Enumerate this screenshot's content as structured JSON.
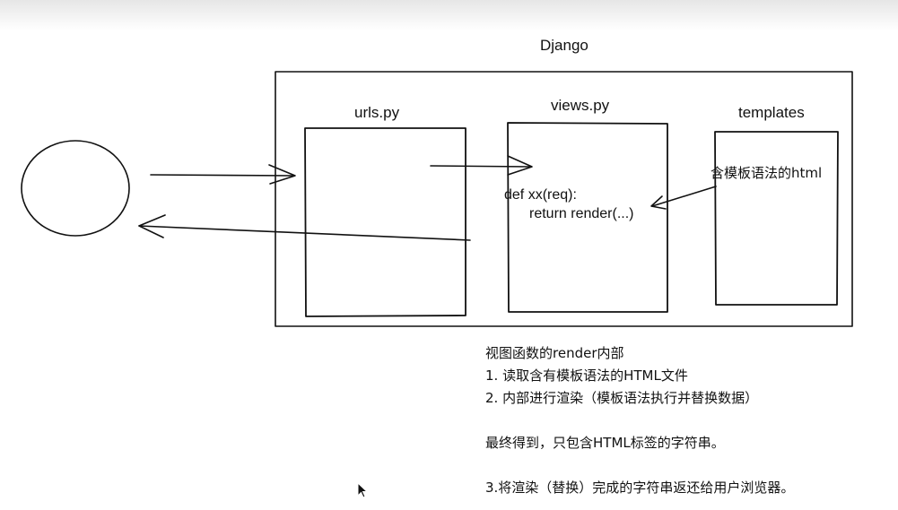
{
  "diagram": {
    "title": "Django",
    "boxes": {
      "urls": "urls.py",
      "views": "views.py",
      "templates": "templates"
    },
    "code": {
      "line1": "def xx(req):",
      "line2": "return render(...)"
    },
    "template_note": "含模板语法的html"
  },
  "notes": {
    "heading": "视图函数的render内部",
    "step1": "1. 读取含有模板语法的HTML文件",
    "step2": "2. 内部进行渲染（模板语法执行并替换数据）",
    "result": "最终得到，只包含HTML标签的字符串。",
    "step3": "3.将渲染（替换）完成的字符串返还给用户浏览器。"
  },
  "colors": {
    "ink": "#111111"
  }
}
